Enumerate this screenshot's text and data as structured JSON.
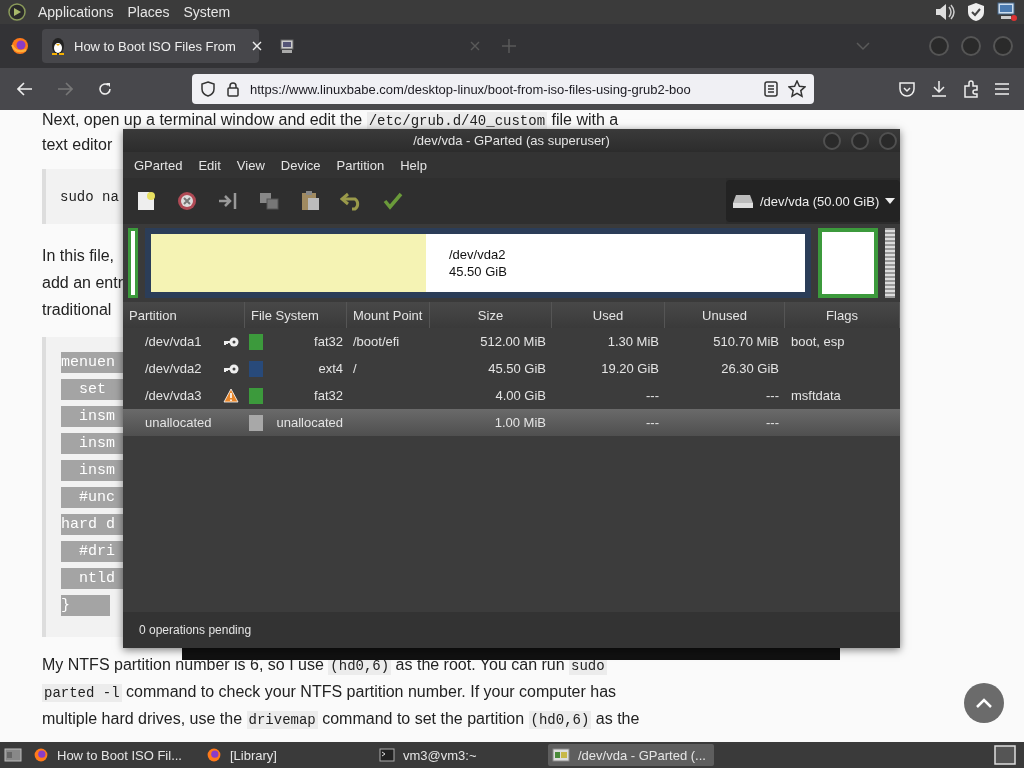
{
  "top_panel": {
    "menus": [
      "Applications",
      "Places",
      "System"
    ]
  },
  "browser": {
    "tabs": [
      {
        "title": "How to Boot ISO Files From",
        "selected": true
      },
      {
        "selected": false
      }
    ],
    "forward": {
      "disabled": true
    },
    "url": "https://www.linuxbabe.com/desktop-linux/boot-from-iso-files-using-grub2-boo"
  },
  "article": {
    "intro": [
      {
        "text": "Next, open up a terminal window and edit the "
      },
      {
        "text": "/etc/grub.d/40_custom",
        "code": true
      },
      {
        "text": " file with a"
      }
    ],
    "intro_end": "text editor",
    "command": "sudo na",
    "lines": [
      "In this file,",
      "add an entr",
      "traditional"
    ],
    "code_lines": [
      "menuen",
      "  set ",
      "  insm",
      "  insm",
      "  insm",
      "  #unc",
      "hard d",
      "  #dri",
      "  ntld",
      "}"
    ],
    "outro": [
      [
        {
          "text": "My NTFS partition number is 6, so I use "
        },
        {
          "text": "(hd0,6)",
          "code": true
        },
        {
          "text": " as the root. You can run "
        },
        {
          "text": "sudo",
          "code": true
        }
      ],
      [
        {
          "text": "parted -l",
          "code": true
        },
        {
          "text": " command to check your NTFS partition number. If your computer has"
        }
      ],
      [
        {
          "text": "multiple hard drives, use the "
        },
        {
          "text": "drivemap",
          "code": true
        },
        {
          "text": " command to set the partition "
        },
        {
          "text": "(hd0,6)",
          "code": true
        },
        {
          "text": " as the"
        }
      ]
    ]
  },
  "gparted": {
    "title": "/dev/vda - GParted (as superuser)",
    "menus": [
      "GParted",
      "Edit",
      "View",
      "Device",
      "Partition",
      "Help"
    ],
    "device": "/dev/vda (50.00 GiB)",
    "graph": [
      {
        "kind": "sliver",
        "color": "#3c9a3c"
      },
      {
        "kind": "main",
        "color": "#2b3d58",
        "label": "/dev/vda2",
        "size": "45.50 GiB",
        "level": 0.42
      },
      {
        "kind": "block",
        "color": "#3c9a3c"
      },
      {
        "kind": "free"
      }
    ],
    "columns": [
      "Partition",
      "File System",
      "Mount Point",
      "Size",
      "Used",
      "Unused",
      "Flags"
    ],
    "partitions": [
      {
        "name": "/dev/vda1",
        "kind": "mounted",
        "color": "#3c9a3c",
        "fs": "fat32",
        "mount": "/boot/efi",
        "size": "512.00 MiB",
        "used": "1.30 MiB",
        "unused": "510.70 MiB",
        "flags": "boot, esp",
        "selected": false
      },
      {
        "name": "/dev/vda2",
        "kind": "mounted",
        "color": "#284a7a",
        "fs": "ext4",
        "mount": "/",
        "size": "45.50 GiB",
        "used": "19.20 GiB",
        "unused": "26.30 GiB",
        "selected": false
      },
      {
        "name": "/dev/vda3",
        "kind": "warning",
        "color": "#3c9a3c",
        "fs": "fat32",
        "size": "4.00 GiB",
        "used": "---",
        "unused": "---",
        "flags": "msftdata",
        "selected": false
      },
      {
        "name": "unallocated",
        "color": "#a8a8a8",
        "fs": "unallocated",
        "size": "1.00 MiB",
        "used": "---",
        "unused": "---",
        "selected": true
      }
    ],
    "status": "0 operations pending"
  },
  "taskbar": [
    {
      "title": "How to Boot ISO Fil...",
      "kind": "browser",
      "selected": false
    },
    {
      "title": "[Library]",
      "kind": "browser",
      "selected": false
    },
    {
      "title": "vm3@vm3:~",
      "kind": "terminal",
      "selected": false
    },
    {
      "title": "/dev/vda - GParted (...",
      "kind": "disk",
      "selected": true
    }
  ]
}
